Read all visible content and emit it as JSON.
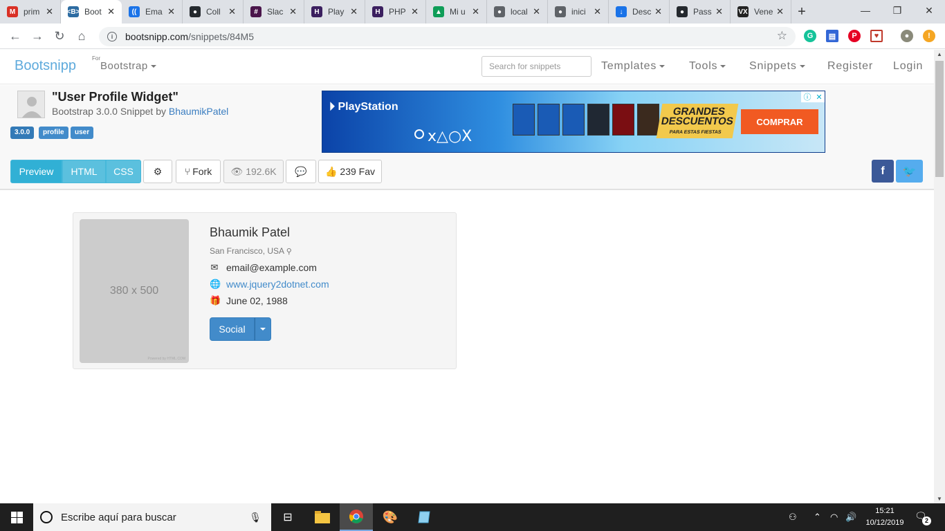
{
  "browser": {
    "tabs": [
      {
        "label": "prim",
        "icon": "gmail-icon",
        "color": "#d93025",
        "glyph": "M"
      },
      {
        "label": "Boot",
        "icon": "bootsnipp-icon",
        "color": "#2d6ca2",
        "glyph": "<B>",
        "active": true
      },
      {
        "label": "Ema",
        "icon": "email-app-icon",
        "color": "#1a73e8",
        "glyph": "(("
      },
      {
        "label": "Coll",
        "icon": "github-icon",
        "color": "#24292e",
        "glyph": "●"
      },
      {
        "label": "Slac",
        "icon": "slack-icon",
        "color": "#4a154b",
        "glyph": "#"
      },
      {
        "label": "Play",
        "icon": "codehs-icon",
        "color": "#3b1f5f",
        "glyph": "H"
      },
      {
        "label": "PHP",
        "icon": "codehs-icon",
        "color": "#3b1f5f",
        "glyph": "H"
      },
      {
        "label": "Mi u",
        "icon": "google-drive-icon",
        "color": "#0f9d58",
        "glyph": "▲"
      },
      {
        "label": "local",
        "icon": "globe-icon",
        "color": "#5f6368",
        "glyph": "●"
      },
      {
        "label": "inici",
        "icon": "globe-icon",
        "color": "#5f6368",
        "glyph": "●"
      },
      {
        "label": "Desc",
        "icon": "download-icon",
        "color": "#1a73e8",
        "glyph": "↓"
      },
      {
        "label": "Pass",
        "icon": "github-icon",
        "color": "#24292e",
        "glyph": "●"
      },
      {
        "label": "Vene",
        "icon": "vx-icon",
        "color": "#222222",
        "glyph": "VX"
      }
    ],
    "url_host": "bootsnipp.com",
    "url_path": "/snippets/84M5"
  },
  "nav": {
    "brand": "Bootsnipp",
    "for_label": "For",
    "bootstrap_label": "Bootstrap",
    "search_placeholder": "Search for snippets",
    "templates": "Templates",
    "tools": "Tools",
    "snippets": "Snippets",
    "register": "Register",
    "login": "Login"
  },
  "snippet": {
    "title": "\"User Profile Widget\"",
    "subtitle_prefix": "Bootstrap 3.0.0 Snippet by ",
    "author": "BhaumikPatel",
    "tags": [
      "3.0.0",
      "profile",
      "user"
    ],
    "tabs": {
      "preview": "Preview",
      "html": "HTML",
      "css": "CSS"
    },
    "fork_label": "Fork",
    "views": "192.6K",
    "fav_label": "239 Fav"
  },
  "ad": {
    "brand": "PlayStation",
    "headline": "GRANDES DESCUENTOS",
    "tagline": "PARA ESTAS FIESTAS",
    "cta": "COMPRAR"
  },
  "profile": {
    "placeholder_text": "380 x 500",
    "placeholder_credit": "Powered by HTML.COM",
    "name": "Bhaumik Patel",
    "location": "San Francisco, USA",
    "email": "email@example.com",
    "website": "www.jquery2dotnet.com",
    "birthday": "June 02, 1988",
    "social_button": "Social"
  },
  "taskbar": {
    "search_placeholder": "Escribe aquí para buscar",
    "time": "15:21",
    "date": "10/12/2019",
    "notifications": "2"
  },
  "colors": {
    "brand": "#5eaadc",
    "info_button": "#5bc0de",
    "primary": "#428bca",
    "facebook": "#3b5998",
    "twitter": "#55acee"
  }
}
